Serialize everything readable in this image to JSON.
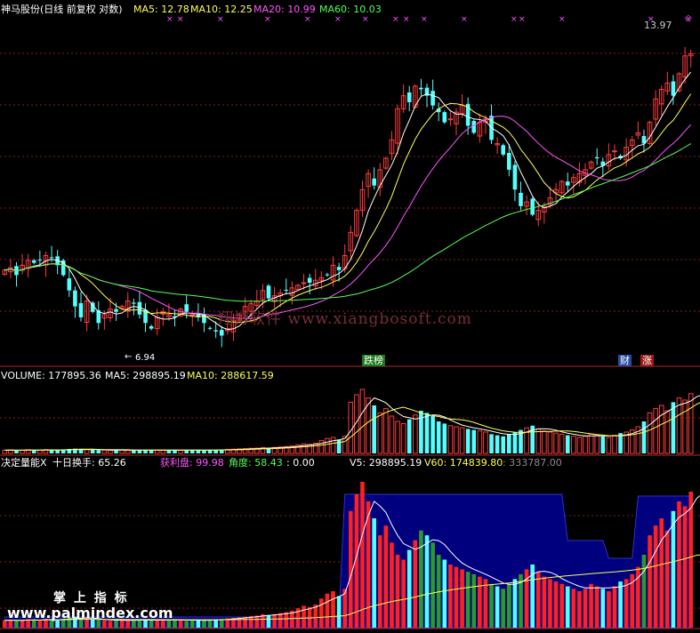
{
  "main_panel": {
    "title": "神马股份(日线 前复权 对数)",
    "legend": [
      {
        "label": "MA5: 12.78",
        "color": "#ffff54"
      },
      {
        "label": "MA10: 12.25",
        "color": "#ffff54"
      },
      {
        "label": "MA20: 10.99",
        "color": "#ff54ff"
      },
      {
        "label": "MA60: 10.03",
        "color": "#54ff54"
      }
    ],
    "high_label": "13.97",
    "low_label": "6.94",
    "badges": [
      {
        "label": "跌榜",
        "bg": "#1a7a1a",
        "fg": "#ffffff"
      },
      {
        "label": "财",
        "bg": "#2a4ca0",
        "fg": "#ffffff"
      },
      {
        "label": "涨",
        "bg": "#a01a1a",
        "fg": "#ffffff"
      }
    ]
  },
  "volume_panel": {
    "legend": [
      {
        "label": "VOLUME: 177895.36",
        "color": "#ffffff"
      },
      {
        "label": "MA5: 298895.19",
        "color": "#ffffff"
      },
      {
        "label": "MA10: 288617.59",
        "color": "#ffff54"
      }
    ]
  },
  "indicator_panel": {
    "legend": [
      {
        "label": "决定量能X",
        "color": "#ffffff"
      },
      {
        "label": "十日换手: 65.26",
        "color": "#ffffff"
      },
      {
        "label": "获利盘: 99.98",
        "color": "#ff54ff"
      },
      {
        "label": "角度: 58.43",
        "color": "#54ff54"
      },
      {
        "label": ": 0.00",
        "color": "#ffffff"
      },
      {
        "label": "V5: 298895.19",
        "color": "#ffffff"
      },
      {
        "label": "V60: 174839.80",
        "color": "#ffff54"
      },
      {
        "label": ": 333787.00",
        "color": "#8c8c8c"
      }
    ]
  },
  "watermarks": {
    "site1": "翔博软件 www.xiangbosoft.com",
    "site2_top": "掌 上 指 标",
    "site2_bottom": "www.palmindex.com"
  },
  "colors": {
    "up": "#ff3c3c",
    "down": "#54ffff",
    "ma5": "#ffffff",
    "ma10": "#ffff54",
    "ma20": "#ff54ff",
    "ma60": "#54ff54",
    "grid": "#8b1a1a",
    "area_fill": "#00007f"
  },
  "chart_data": {
    "type": "candlestick",
    "scale": "log",
    "ylim": [
      6.5,
      15.0
    ],
    "close": [
      8.2,
      8.25,
      8.1,
      8.3,
      8.4,
      8.35,
      8.4,
      8.5,
      8.45,
      8.3,
      8.1,
      7.8,
      7.5,
      7.3,
      7.6,
      7.4,
      7.2,
      7.35,
      7.45,
      7.4,
      7.5,
      7.6,
      7.55,
      7.35,
      7.2,
      7.1,
      7.3,
      7.4,
      7.35,
      7.3,
      7.45,
      7.4,
      7.35,
      7.3,
      7.2,
      7.1,
      7.05,
      6.98,
      7.1,
      7.25,
      7.35,
      7.5,
      7.55,
      7.6,
      7.8,
      7.65,
      7.7,
      7.75,
      7.8,
      7.85,
      7.9,
      7.95,
      7.95,
      8.0,
      8.05,
      8.1,
      8.3,
      8.2,
      8.5,
      9.0,
      9.5,
      10.0,
      10.4,
      10.1,
      10.5,
      10.8,
      11.3,
      12.2,
      12.6,
      12.4,
      12.9,
      12.8,
      12.6,
      12.3,
      12.1,
      11.8,
      11.9,
      12.1,
      12.3,
      11.7,
      11.5,
      11.8,
      11.9,
      11.3,
      11.2,
      10.9,
      10.5,
      10.0,
      9.6,
      9.7,
      9.4,
      9.5,
      9.6,
      9.8,
      10.0,
      10.2,
      10.1,
      10.3,
      10.4,
      10.5,
      10.7,
      10.8,
      10.6,
      10.9,
      11.0,
      10.8,
      11.1,
      11.3,
      11.5,
      11.2,
      11.8,
      12.5,
      12.8,
      13.0,
      12.6,
      13.3,
      13.9,
      13.97
    ],
    "volume": [
      3000,
      3200,
      2800,
      3100,
      3500,
      3300,
      2900,
      3600,
      3400,
      3000,
      3800,
      4200,
      4500,
      3900,
      3600,
      3400,
      3200,
      3000,
      2800,
      3100,
      3300,
      3000,
      2900,
      3200,
      3400,
      3100,
      3000,
      2900,
      3300,
      3500,
      3000,
      2800,
      3200,
      3100,
      2900,
      3300,
      3400,
      3600,
      3800,
      4000,
      4200,
      4500,
      4800,
      5000,
      5500,
      5200,
      5600,
      6000,
      6400,
      7000,
      8000,
      9000,
      8500,
      9500,
      12000,
      14000,
      15000,
      13000,
      16000,
      48000,
      55000,
      60000,
      52000,
      45000,
      38000,
      42000,
      35000,
      30000,
      28000,
      32000,
      36000,
      40000,
      38000,
      35000,
      30000,
      28000,
      26000,
      25000,
      24000,
      23000,
      22000,
      21000,
      20000,
      18000,
      17000,
      16000,
      18000,
      20000,
      22000,
      24000,
      26000,
      23000,
      21000,
      20000,
      19000,
      18000,
      17000,
      16000,
      15000,
      16000,
      18000,
      17000,
      16000,
      15000,
      17000,
      19000,
      20000,
      22000,
      25000,
      30000,
      38000,
      42000,
      45000,
      40000,
      48000,
      52000,
      50000,
      56000,
      60000,
      58000
    ]
  }
}
